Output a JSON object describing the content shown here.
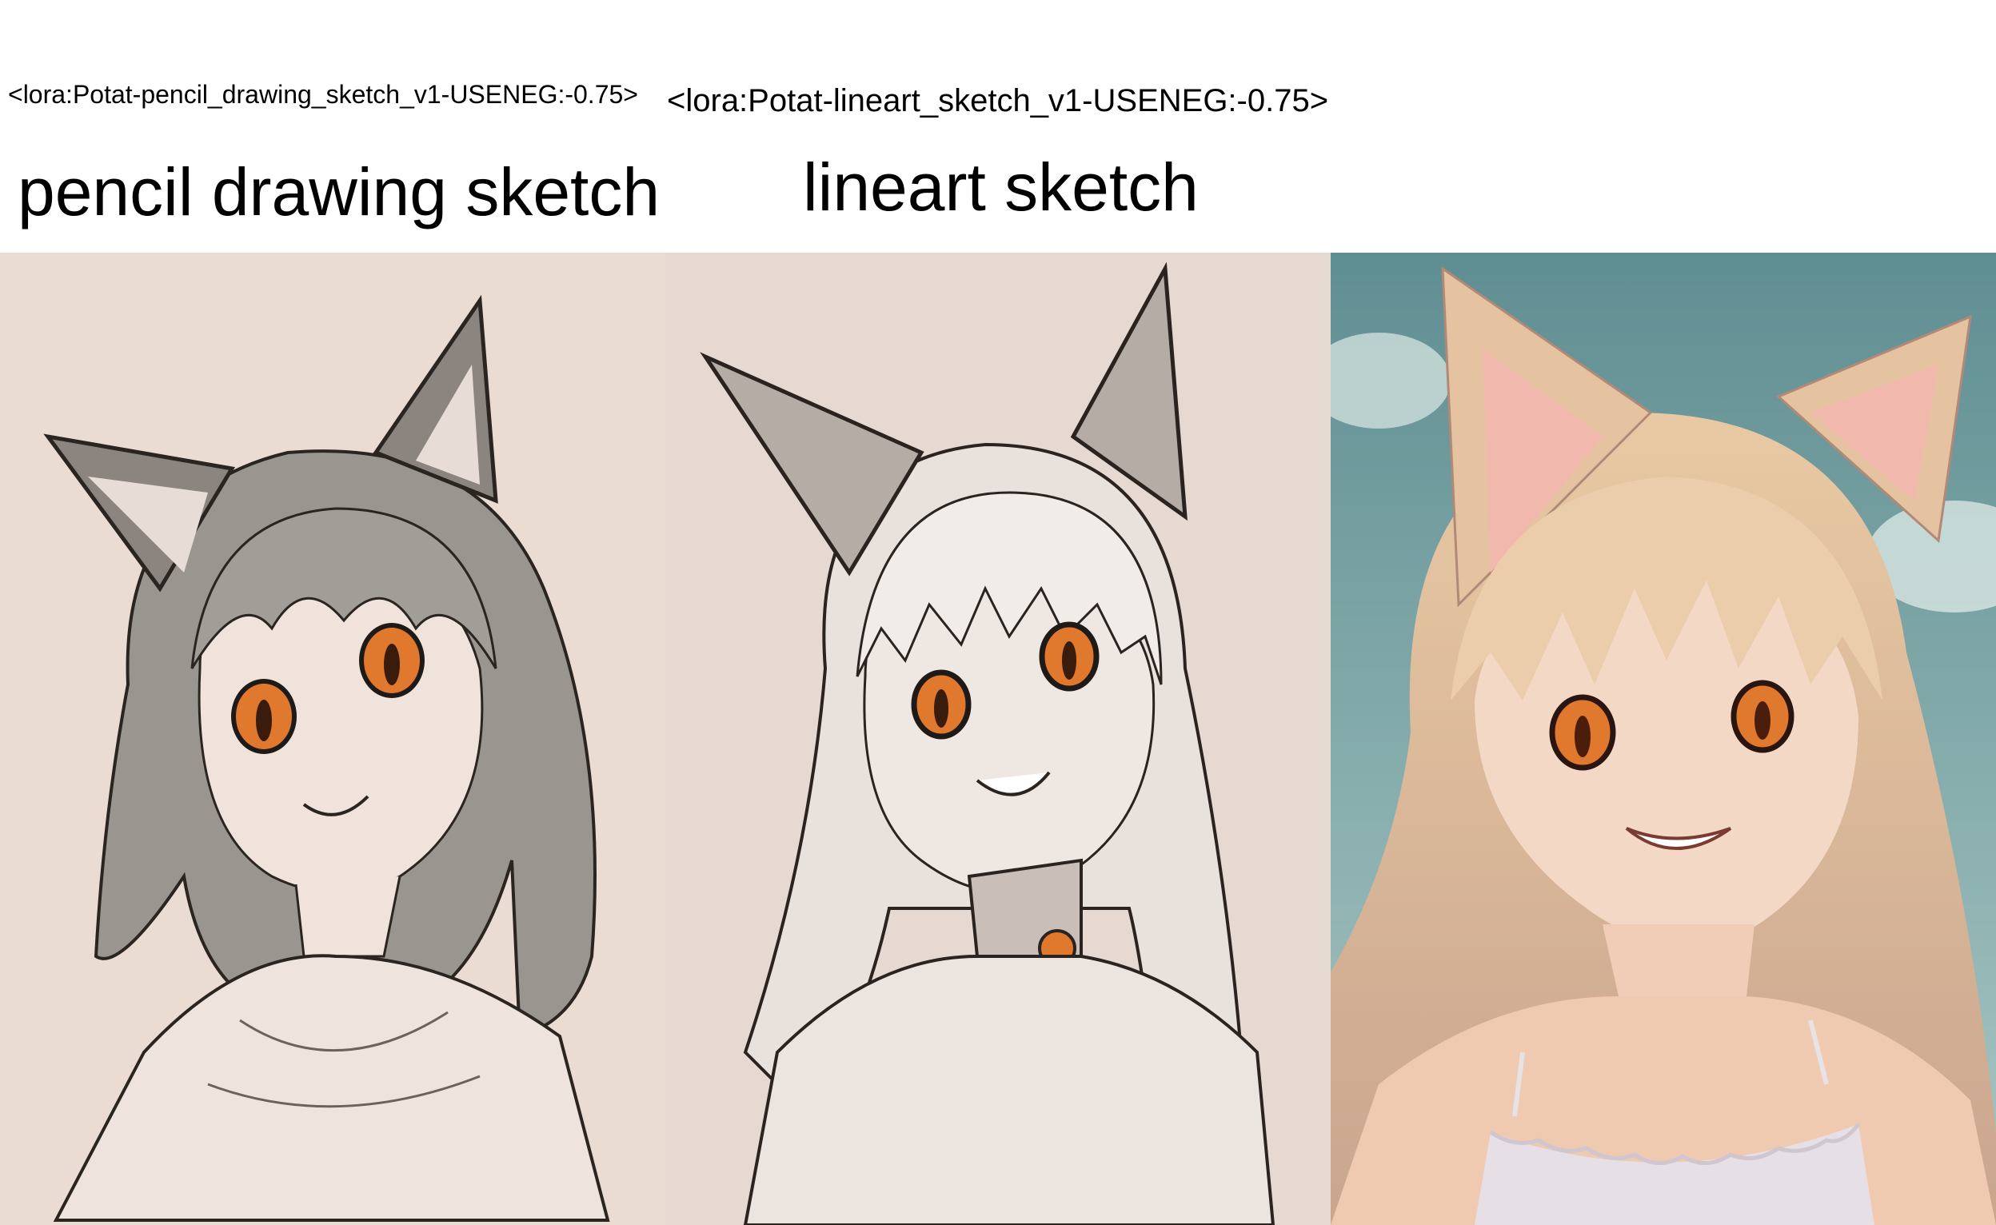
{
  "columns": [
    {
      "lora_tag": "<lora:Potat-pencil_drawing_sketch_v1-USENEG:-0.75>",
      "title": "pencil drawing sketch"
    },
    {
      "lora_tag": "<lora:Potat-lineart_sketch_v1-USENEG:-0.75>",
      "title": "lineart sketch"
    },
    {
      "lora_tag": "",
      "title": ""
    }
  ],
  "colors": {
    "sketch_bg": "#eadbd3",
    "lineart_bg": "#e6d9d1",
    "sky": "#6f9a9b",
    "eye_orange": "#e0782e",
    "hair_gray": "#9b958f",
    "hair_blonde": "#e8c9a7"
  }
}
